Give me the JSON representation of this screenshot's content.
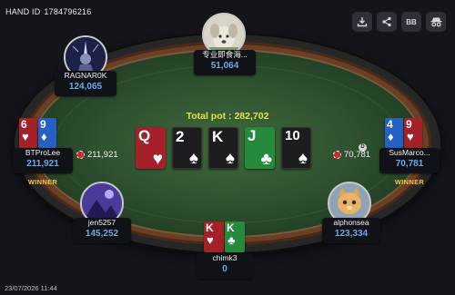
{
  "hand": {
    "id_label": "HAND ID",
    "id_value": "1784796216"
  },
  "toolbar": {
    "download_icon": "download-icon",
    "share_icon": "share-icon",
    "bb_label": "BB",
    "disguise_icon": "incognito-icon"
  },
  "pot": {
    "label": "Total pot : 282,702"
  },
  "board": [
    {
      "rank": "Q",
      "suit": "♥",
      "color": "red"
    },
    {
      "rank": "2",
      "suit": "♠",
      "color": "black"
    },
    {
      "rank": "K",
      "suit": "♠",
      "color": "black"
    },
    {
      "rank": "J",
      "suit": "♣",
      "color": "green"
    },
    {
      "rank": "10",
      "suit": "♠",
      "color": "black"
    }
  ],
  "players": {
    "top": {
      "name": "专业即食海...",
      "stack": "51,064"
    },
    "ragnar": {
      "name": "RAGNAR0K",
      "stack": "124,065"
    },
    "btprolee": {
      "name": "BTProLee",
      "stack": "211,921",
      "winner": "WINNER",
      "bet": "211,921",
      "cards": [
        {
          "rank": "6",
          "suit": "♥",
          "color": "red"
        },
        {
          "rank": "9",
          "suit": "♦",
          "color": "blue"
        }
      ]
    },
    "susmarco": {
      "name": "SusMarco...",
      "stack": "70,781",
      "winner": "WINNER",
      "bet": "70,781",
      "cards": [
        {
          "rank": "4",
          "suit": "♦",
          "color": "blue"
        },
        {
          "rank": "9",
          "suit": "♥",
          "color": "red"
        }
      ]
    },
    "jen": {
      "name": "jen5257",
      "stack": "145,252"
    },
    "alphonsea": {
      "name": "alphonsea",
      "stack": "123,334"
    },
    "chimk": {
      "name": "chimk3",
      "stack": "0",
      "cards": [
        {
          "rank": "K",
          "suit": "♥",
          "color": "red"
        },
        {
          "rank": "K",
          "suit": "♣",
          "color": "green"
        }
      ]
    }
  },
  "dealer_button": "D",
  "footer": {
    "date": "23/07/2026 11:44"
  }
}
